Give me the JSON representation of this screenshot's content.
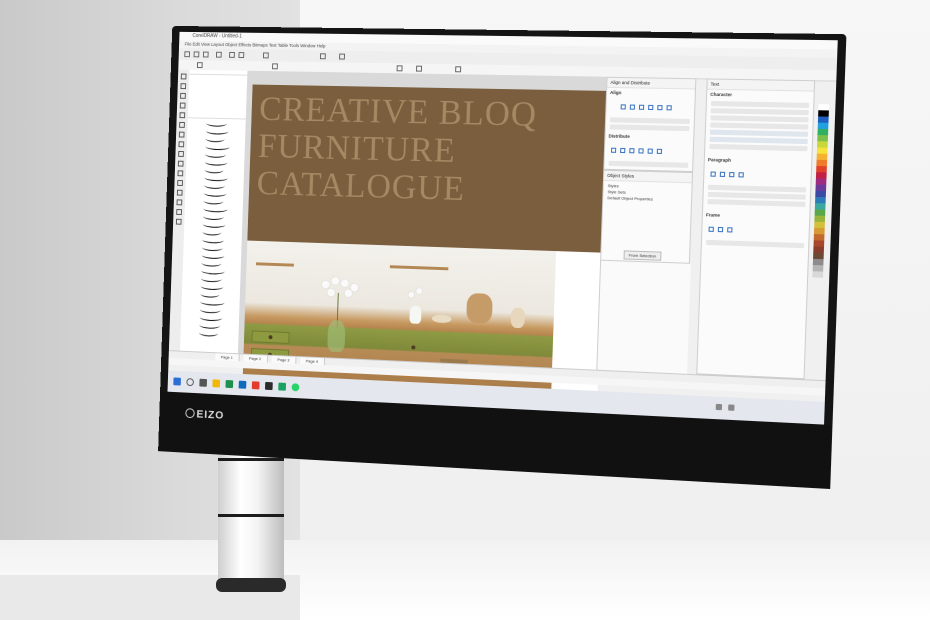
{
  "app": {
    "title": "CorelDRAW - Untitled-1",
    "menu": "File  Edit  View  Layout  Object  Effects  Bitmaps  Text  Table  Tools  Window  Help"
  },
  "canvas": {
    "headline": [
      "CREATIVE BLOQ",
      "FURNITURE",
      "CATALOGUE"
    ]
  },
  "panels": {
    "align": {
      "title": "Align and Distribute",
      "align_label": "Align",
      "distribute_label": "Distribute"
    },
    "objects": {
      "title": "Object Styles",
      "items": [
        "Styles",
        "Style Sets",
        "Default Object Properties"
      ],
      "button": "From Selection"
    },
    "text": {
      "title": "Text",
      "character_label": "Character",
      "paragraph_label": "Paragraph",
      "frame_label": "Frame"
    }
  },
  "pages": {
    "tabs": [
      "Page 1",
      "Page 2",
      "Page 3",
      "Page 4"
    ]
  },
  "monitor": {
    "brand": "EIZO"
  },
  "colors": {
    "banner": "#7a5e3d",
    "headline": "#a48a64",
    "accent": "#3a74c0"
  }
}
